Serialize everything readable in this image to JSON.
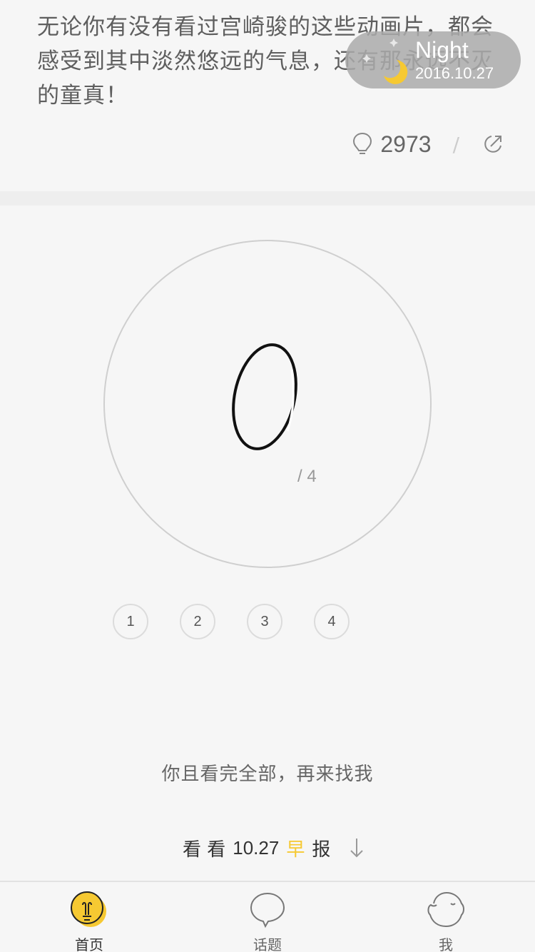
{
  "article": {
    "text": "无论你有没有看过宫崎骏的这些动画片，都会感受到其中淡然悠远的气息，还有那永远不灭的童真！",
    "like_count": "2973",
    "separator": "/"
  },
  "night_mode": {
    "title": "Night",
    "date": "2016.10.27"
  },
  "quiz": {
    "score": "0",
    "total": "/ 4",
    "questions": [
      "1",
      "2",
      "3",
      "4"
    ],
    "hint": "你且看完全部，再来找我",
    "morning_link": {
      "prefix": "看 看",
      "date": "10.27",
      "accent": "早",
      "suffix": "报"
    }
  },
  "tabbar": {
    "tabs": [
      {
        "label": "首页",
        "icon": "bulb-icon",
        "active": true
      },
      {
        "label": "话题",
        "icon": "speech-bubble-icon",
        "active": false
      },
      {
        "label": "我",
        "icon": "face-icon",
        "active": false
      }
    ]
  },
  "colors": {
    "accent": "#f6c932",
    "background": "#f6f6f6",
    "night_pill": "#aaaaaa"
  }
}
